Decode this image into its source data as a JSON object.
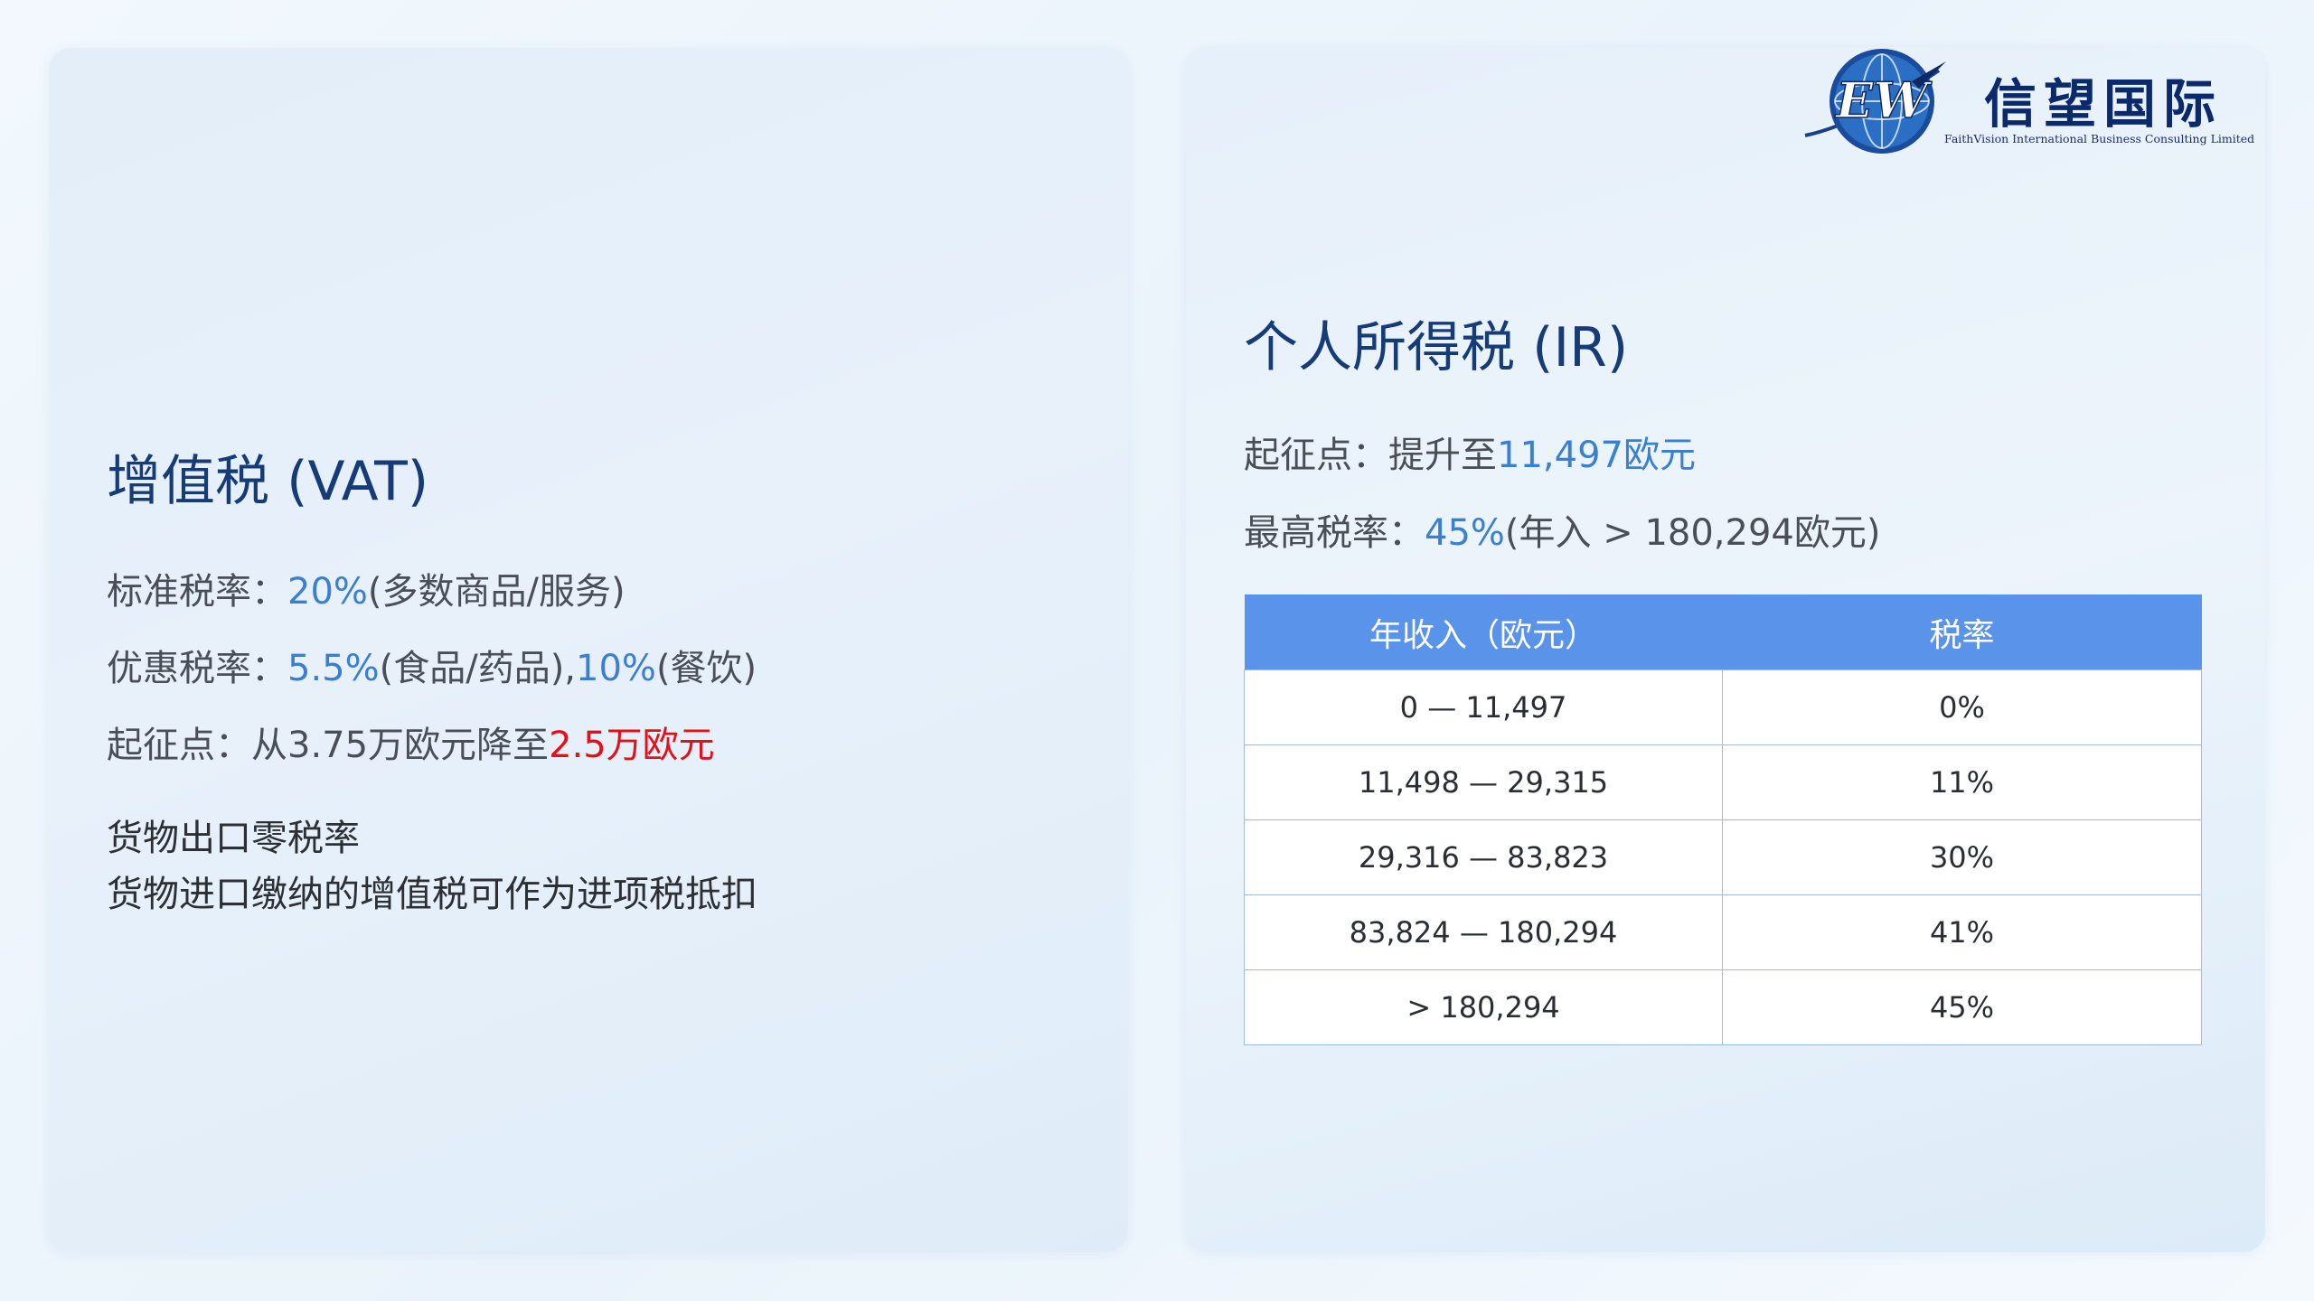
{
  "logo": {
    "monogram": "EW",
    "name_cn": "信望国际",
    "name_en": "FaithVision International Business Consulting Limited"
  },
  "vat": {
    "title": "增值税 (VAT)",
    "standard": {
      "label": "标准税率：",
      "value": "20%",
      "note": "(多数商品/服务)"
    },
    "reduced": {
      "label": "优惠税率：",
      "value1": "5.5%",
      "note1": "(食品/药品),",
      "value2": "10%",
      "note2": "(餐饮)"
    },
    "threshold": {
      "label": "起征点：从3.75万欧元降至",
      "value": "2.5万欧元"
    },
    "note1": "货物出口零税率",
    "note2": "货物进口缴纳的增值税可作为进项税抵扣"
  },
  "ir": {
    "title": "个人所得税 (IR)",
    "threshold": {
      "label": "起征点：提升至",
      "value": "11,497欧元"
    },
    "top_rate": {
      "label": "最高税率：",
      "value": "45%",
      "note": "(年入 > 180,294欧元)"
    }
  },
  "table": {
    "headers": [
      "年收入（欧元）",
      "税率"
    ],
    "rows": [
      [
        "0 — 11,497",
        "0%"
      ],
      [
        "11,498 — 29,315",
        "11%"
      ],
      [
        "29,316 — 83,823",
        "30%"
      ],
      [
        "83,824 — 180,294",
        "41%"
      ],
      [
        "> 180,294",
        "45%"
      ]
    ]
  },
  "colors": {
    "accent_blue": "#3b7fd0",
    "heading_navy": "#163c78",
    "highlight_red": "#e3101a",
    "table_header": "#5a93ea"
  }
}
